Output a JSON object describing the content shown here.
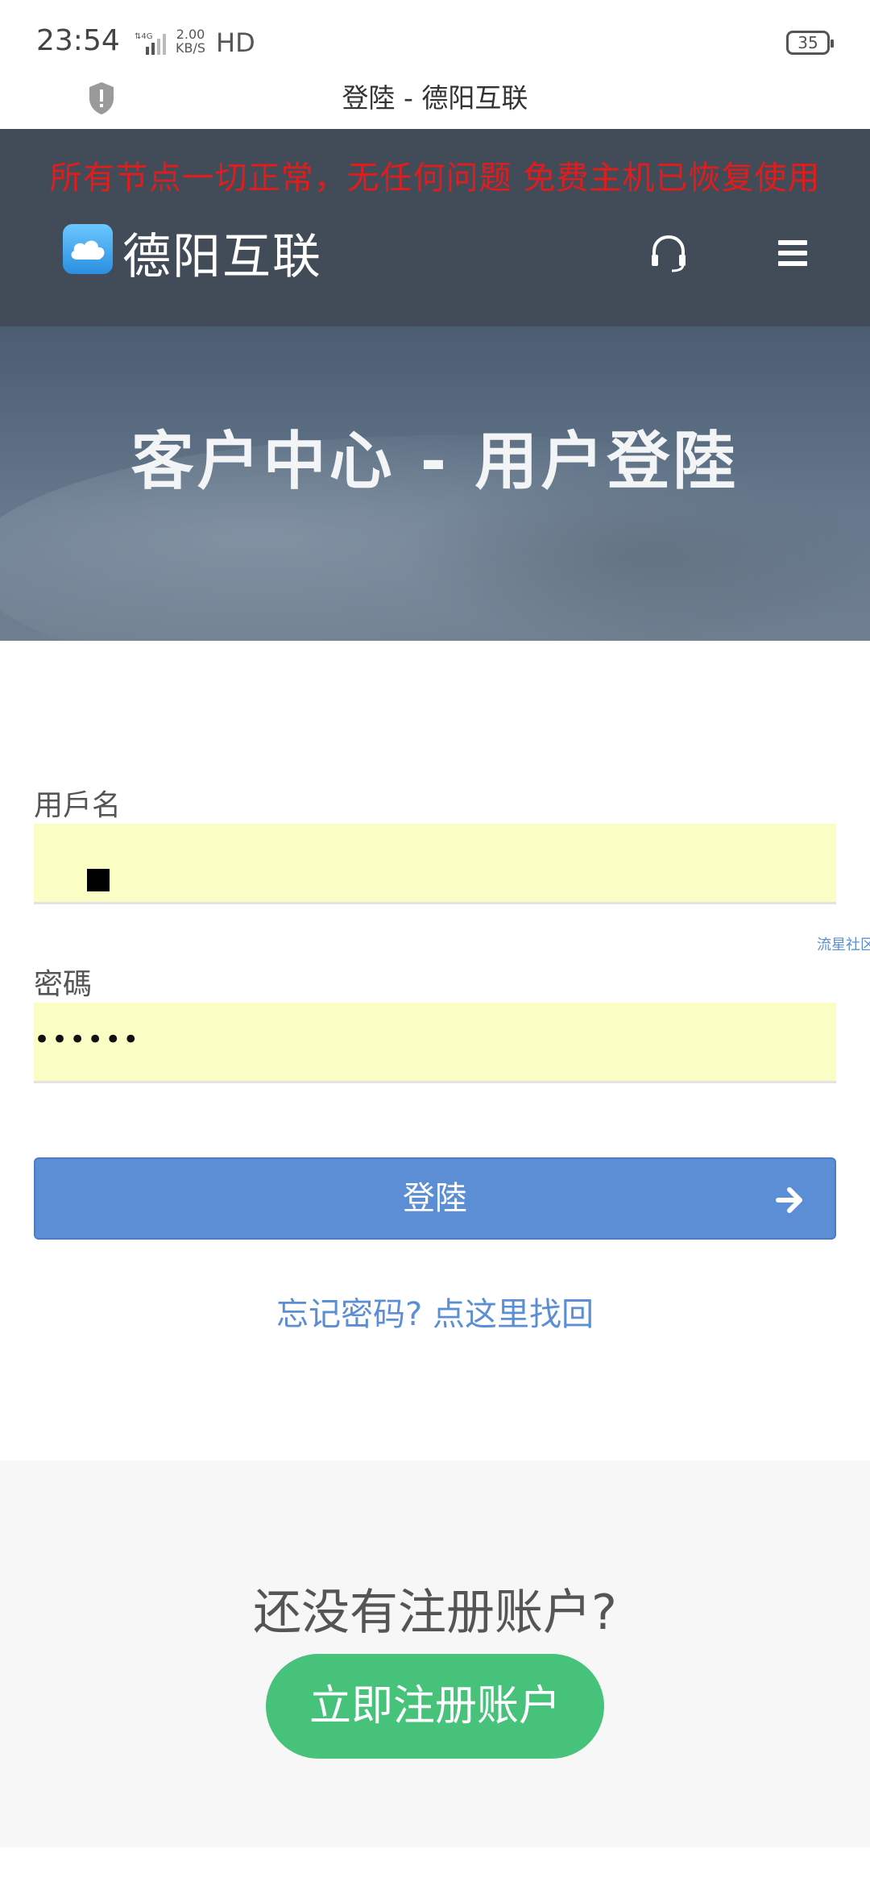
{
  "status_bar": {
    "time": "23:54",
    "network": "4G",
    "speed_value": "2.00",
    "speed_unit": "KB/S",
    "hd": "HD",
    "battery": "35"
  },
  "browser": {
    "page_title": "登陸 - 德阳互联"
  },
  "header": {
    "notice": "所有节点一切正常，无任何问题 免费主机已恢复使用",
    "logo_text": "德阳互联"
  },
  "hero": {
    "title": "客户中心 - 用户登陸"
  },
  "form": {
    "username_label": "用戶名",
    "password_label": "密碼",
    "password_value": "••••••",
    "side_link": "流星社区",
    "login_button": "登陸",
    "forgot_link": "忘记密码? 点这里找回"
  },
  "register": {
    "question": "还没有注册账户?",
    "button": "立即注册账户"
  },
  "colors": {
    "header_bg": "#424c59",
    "notice": "#e01c1c",
    "input_bg": "#fafdc4",
    "primary": "#5b8ed4",
    "register": "#46c27a"
  }
}
